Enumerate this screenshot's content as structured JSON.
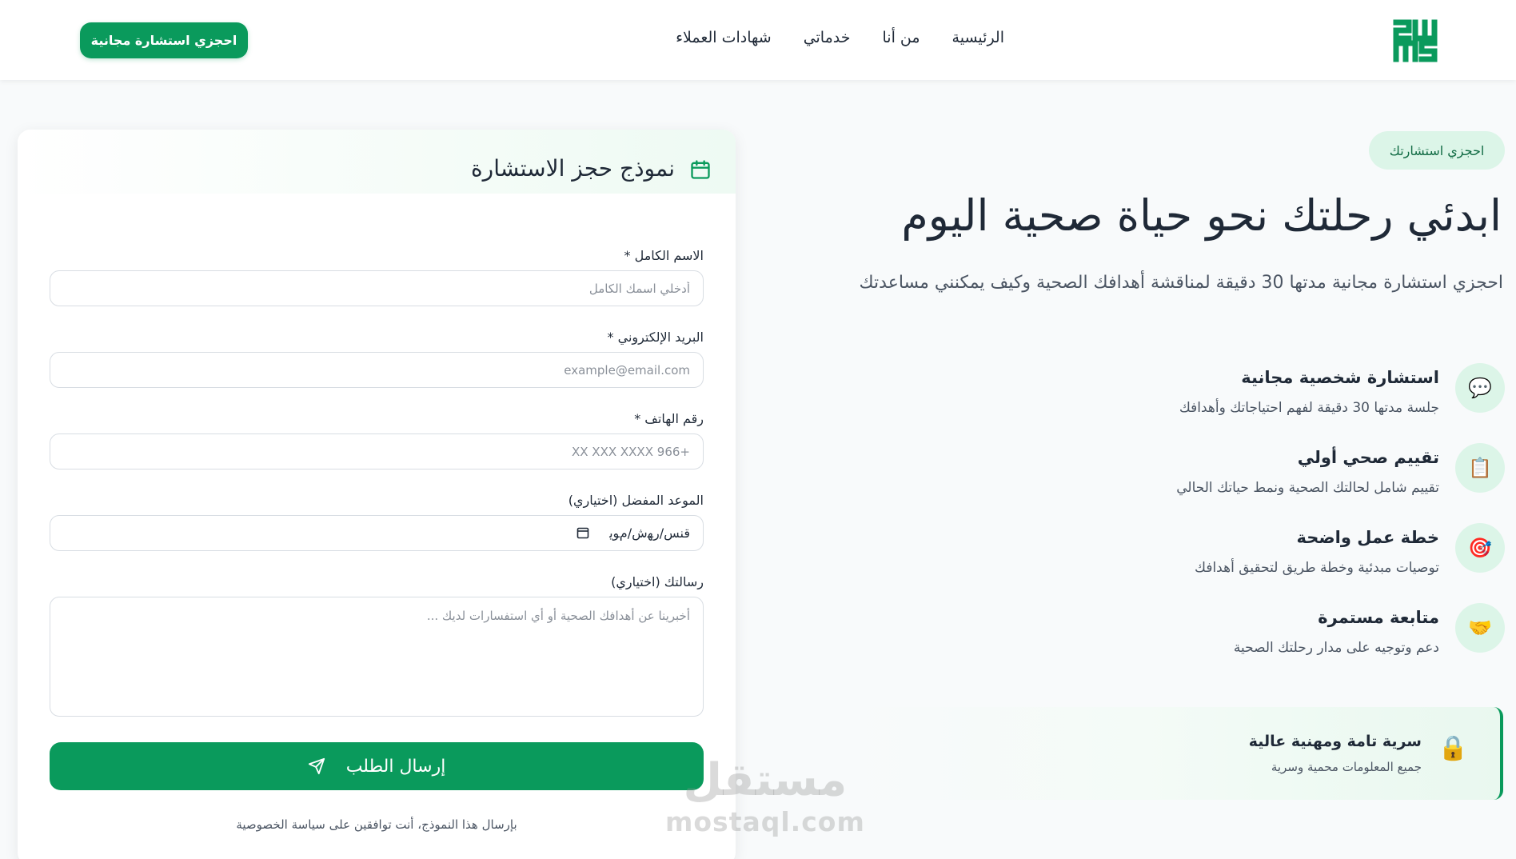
{
  "header": {
    "nav": [
      "الرئيسية",
      "من أنا",
      "خدماتي",
      "شهادات العملاء"
    ],
    "cta": "احجزي استشارة مجانية"
  },
  "hero": {
    "pill": "احجزي استشارتك",
    "title": "ابدئي رحلتك نحو حياة صحية اليوم",
    "subtitle": "احجزي استشارة مجانية مدتها 30 دقيقة لمناقشة أهدافك الصحية وكيف يمكنني مساعدتك"
  },
  "features": [
    {
      "icon": "speech-bubble-icon",
      "glyph": "💬",
      "title": "استشارة شخصية مجانية",
      "desc": "جلسة مدتها 30 دقيقة لفهم احتياجاتك وأهدافك"
    },
    {
      "icon": "clipboard-icon",
      "glyph": "📋",
      "title": "تقييم صحي أولي",
      "desc": "تقييم شامل لحالتك الصحية ونمط حياتك الحالي"
    },
    {
      "icon": "target-icon",
      "glyph": "🎯",
      "title": "خطة عمل واضحة",
      "desc": "توصيات مبدئية وخطة طريق لتحقيق أهدافك"
    },
    {
      "icon": "handshake-icon",
      "glyph": "🤝",
      "title": "متابعة مستمرة",
      "desc": "دعم وتوجيه على مدار رحلتك الصحية"
    }
  ],
  "privacy": {
    "title": "سرية تامة ومهنية عالية",
    "desc": "جميع المعلومات محمية وسرية",
    "glyph": "🔒"
  },
  "form": {
    "title": "نموذج حجز الاستشارة",
    "name_label": "الاسم الكامل *",
    "name_placeholder": "أدخلي اسمك الكامل",
    "email_label": "البريد الإلكتروني *",
    "email_placeholder": "example@email.com",
    "phone_label": "رقم الهاتف *",
    "phone_placeholder": "+966 XX XXX XXXX",
    "date_label": "الموعد المفضل (اختياري)",
    "date_value": "ﻗﻨﺲ/ﺭﻬﺵ/ﻡﻮﻳ",
    "message_label": "رسالتك (اختياري)",
    "message_placeholder": "أخبرينا عن أهدافك الصحية أو أي استفسارات لديك ...",
    "submit": "إرسال الطلب",
    "note": "بإرسال هذا النموذج، أنت توافقين على سياسة الخصوصية"
  },
  "watermark": {
    "arabic": "مستقل",
    "latin": "mostaql.com"
  },
  "colors": {
    "primary": "#0a9a5c",
    "primary_light": "#dcf5e8",
    "text": "#1f2937",
    "muted": "#4b5563"
  }
}
